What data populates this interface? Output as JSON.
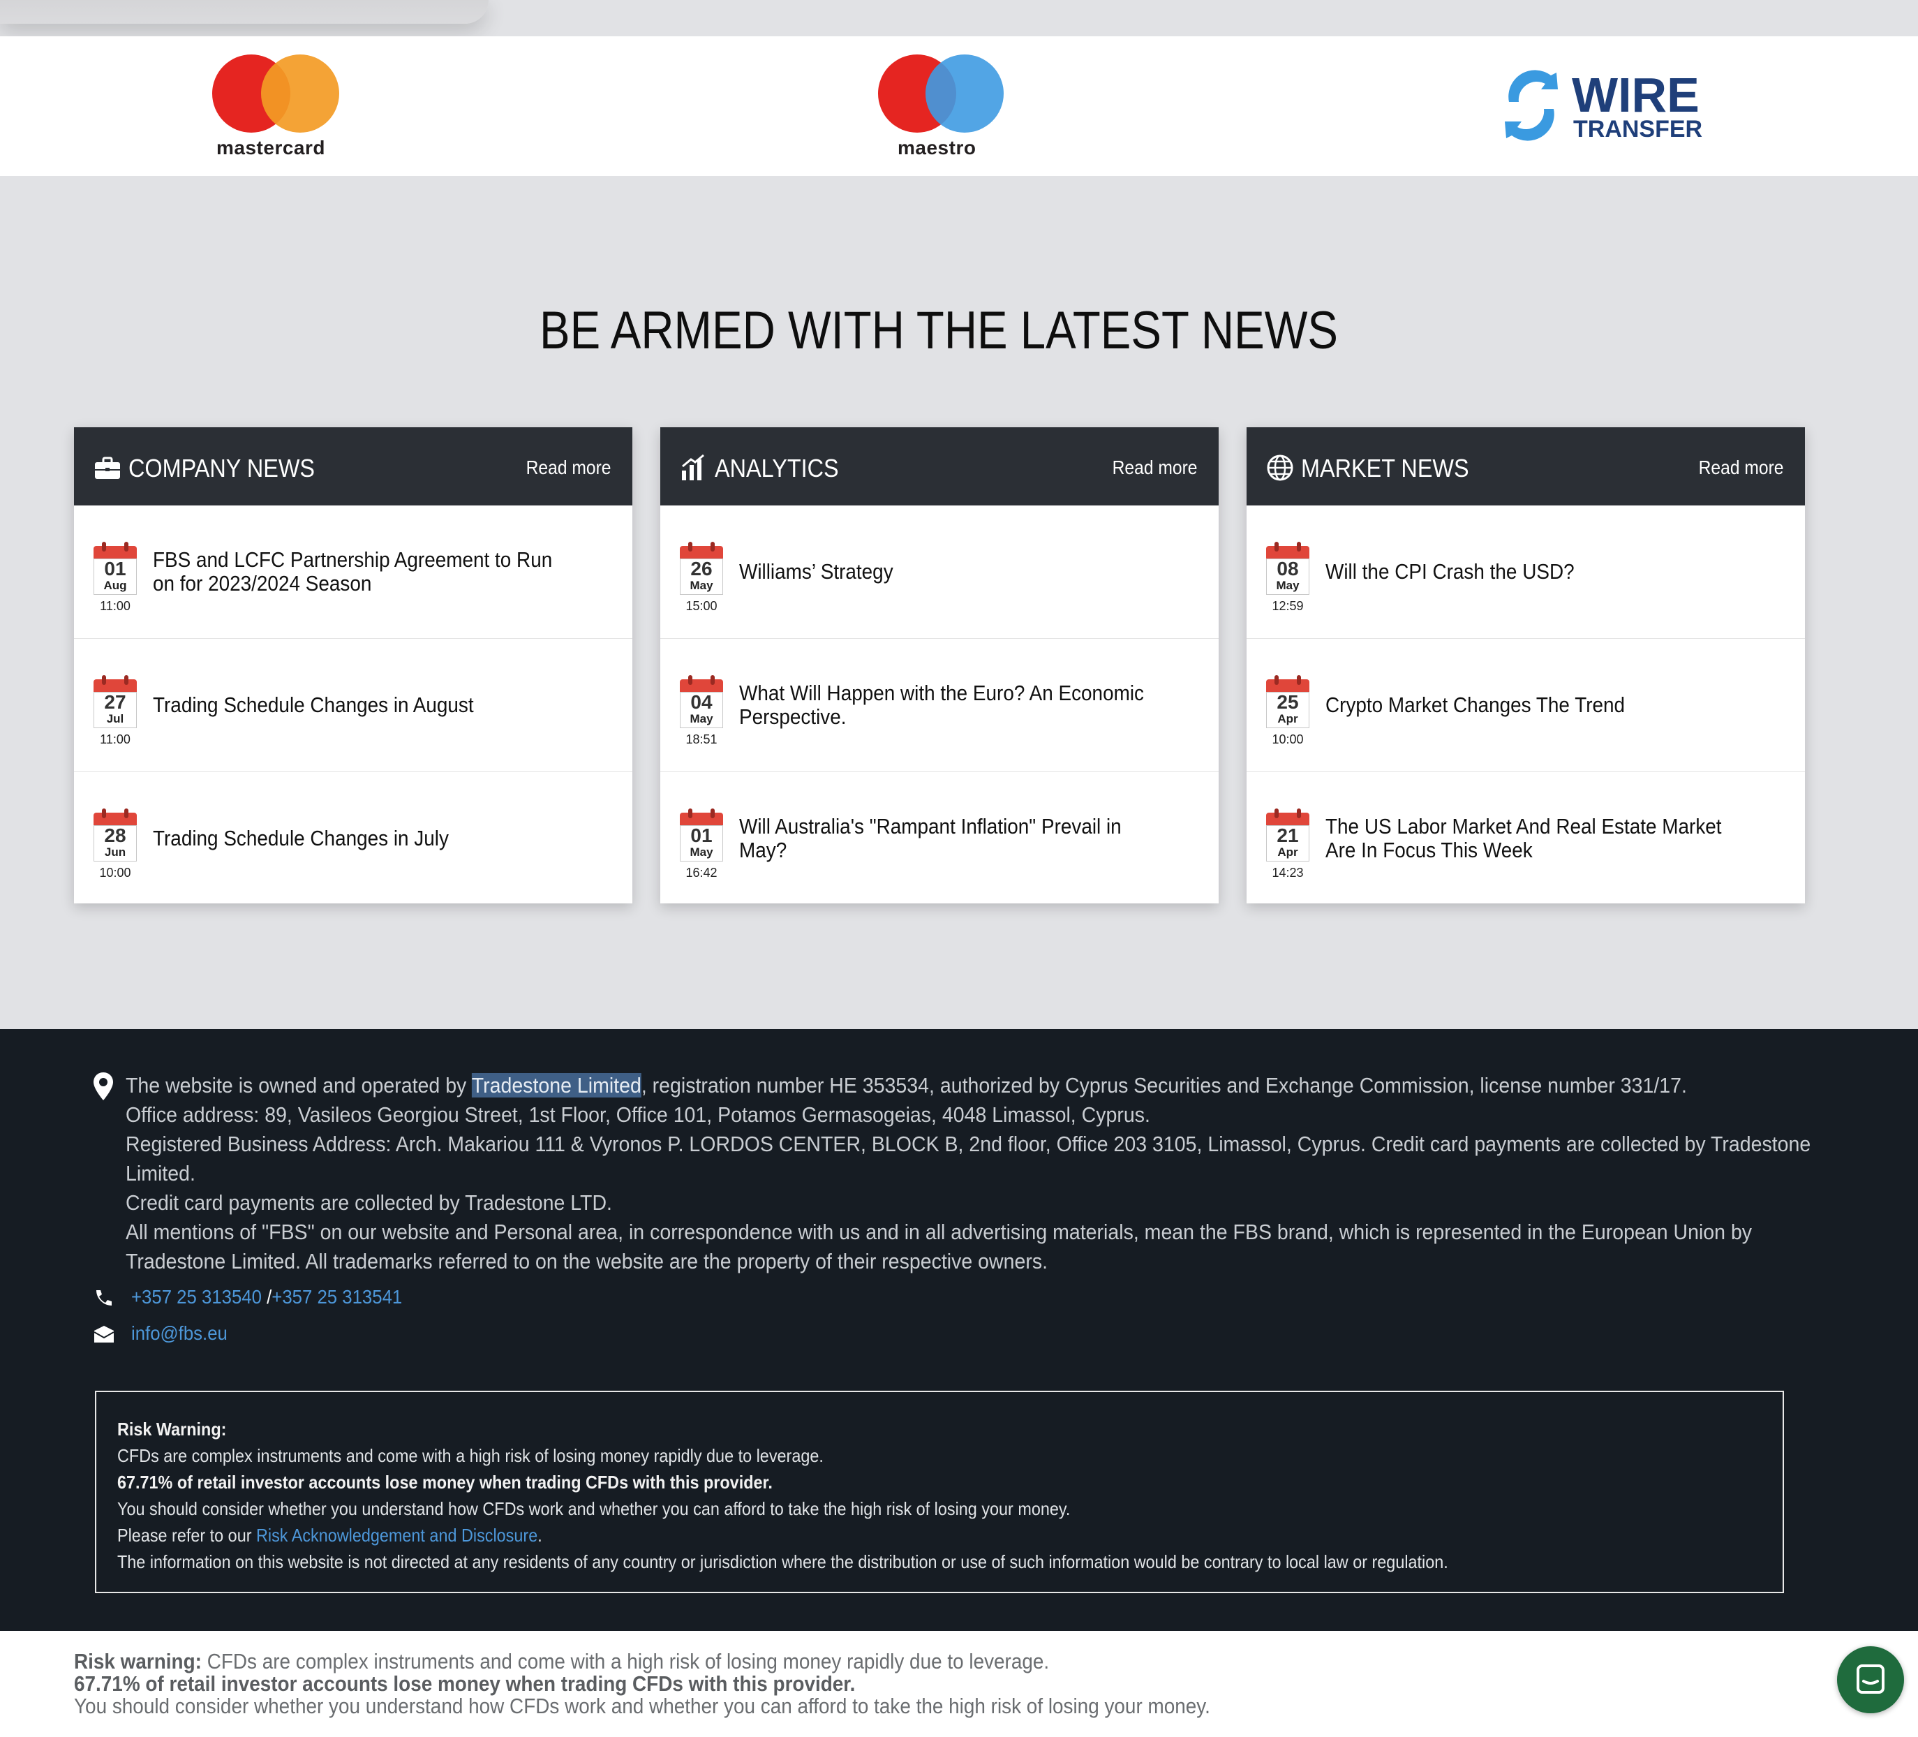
{
  "payments": {
    "mastercard": {
      "label": "mastercard",
      "colors": [
        "#e52521",
        "#f39b25"
      ]
    },
    "maestro": {
      "label": "maestro",
      "colors": [
        "#e52521",
        "#3f9be2"
      ]
    },
    "wire": {
      "line1": "WIRE",
      "line2": "TRANSFER",
      "color": "#1f3f7a",
      "arrow_color": "#3a9ae0"
    }
  },
  "news": {
    "heading": "BE ARMED WITH THE LATEST NEWS",
    "read_more": "Read more",
    "columns": [
      {
        "title": "COMPANY NEWS",
        "icon": "briefcase-icon",
        "items": [
          {
            "day": "01",
            "month": "Aug",
            "time": "11:00",
            "title": "FBS and LCFC Partnership Agreement to Run on for 2023/2024 Season"
          },
          {
            "day": "27",
            "month": "Jul",
            "time": "11:00",
            "title": "Trading Schedule Changes in August"
          },
          {
            "day": "28",
            "month": "Jun",
            "time": "10:00",
            "title": "Trading Schedule Changes in July"
          }
        ]
      },
      {
        "title": "ANALYTICS",
        "icon": "bar-chart-icon",
        "items": [
          {
            "day": "26",
            "month": "May",
            "time": "15:00",
            "title": "Williams’ Strategy"
          },
          {
            "day": "04",
            "month": "May",
            "time": "18:51",
            "title": "What Will Happen with the Euro? An Economic Perspective."
          },
          {
            "day": "01",
            "month": "May",
            "time": "16:42",
            "title": "Will Australia's \"Rampant Inflation\" Prevail in May?"
          }
        ]
      },
      {
        "title": "MARKET NEWS",
        "icon": "globe-icon",
        "items": [
          {
            "day": "08",
            "month": "May",
            "time": "12:59",
            "title": "Will the CPI Crash the USD?"
          },
          {
            "day": "25",
            "month": "Apr",
            "time": "10:00",
            "title": "Crypto Market Changes The Trend"
          },
          {
            "day": "21",
            "month": "Apr",
            "time": "14:23",
            "title": "The US Labor Market And Real Estate Market Are In Focus This Week"
          }
        ]
      }
    ]
  },
  "footer": {
    "line1_pre": "The website is owned and operated by ",
    "line1_highlight": "Tradestone Limited",
    "line1_post": ", registration number HE 353534, authorized by Cyprus Securities and Exchange Commission, license number 331/17.",
    "line2": "Office address: 89, Vasileos Georgiou Street, 1st Floor, Office 101, Potamos Germasogeias, 4048 Limassol, Cyprus.",
    "line3": "Registered Business Address: Arch. Makariou 111 & Vyronos P. LORDOS CENTER, BLOCK B, 2nd floor, Office 203 3105, Limassol, Cyprus. Credit card payments are collected by Tradestone",
    "line4": "Limited.",
    "line5": "Credit card payments are collected by Tradestone LTD.",
    "line6": "All mentions of \"FBS\" on our website and Personal area, in correspondence with us and in all advertising materials, mean the FBS brand, which is represented in the European Union by",
    "line7": "Tradestone Limited. All trademarks referred to on the website are the property of their respective owners.",
    "phone1": "+357 25 313540",
    "phone_sep": " /",
    "phone2": "+357 25 313541",
    "email": "info@fbs.eu",
    "risk": {
      "title": "Risk Warning:",
      "l1": "CFDs are complex instruments and come with a high risk of losing money rapidly due to leverage.",
      "l2": "67.71% of retail investor accounts lose money when trading CFDs with this provider.",
      "l3": "You should consider whether you understand how CFDs work and whether you can afford to take the high risk of losing your money.",
      "l4_pre": "Please refer to our ",
      "l4_link": "Risk Acknowledgement and Disclosure",
      "l4_post": ".",
      "l5": "The information on this website is not directed at any residents of any country or jurisdiction where the distribution or use of such information would be contrary to local law or regulation."
    }
  },
  "bottom_bar": {
    "label": "Risk warning:",
    "l1": " CFDs are complex instruments and come with a high risk of losing money rapidly due to leverage.",
    "l2": "67.71% of retail investor accounts lose money when trading CFDs with this provider.",
    "l3": "You should consider whether you understand how CFDs work and whether you can afford to take the high risk of losing your money."
  },
  "chat": {
    "icon": "chat-icon",
    "color": "#1f6b3d"
  }
}
